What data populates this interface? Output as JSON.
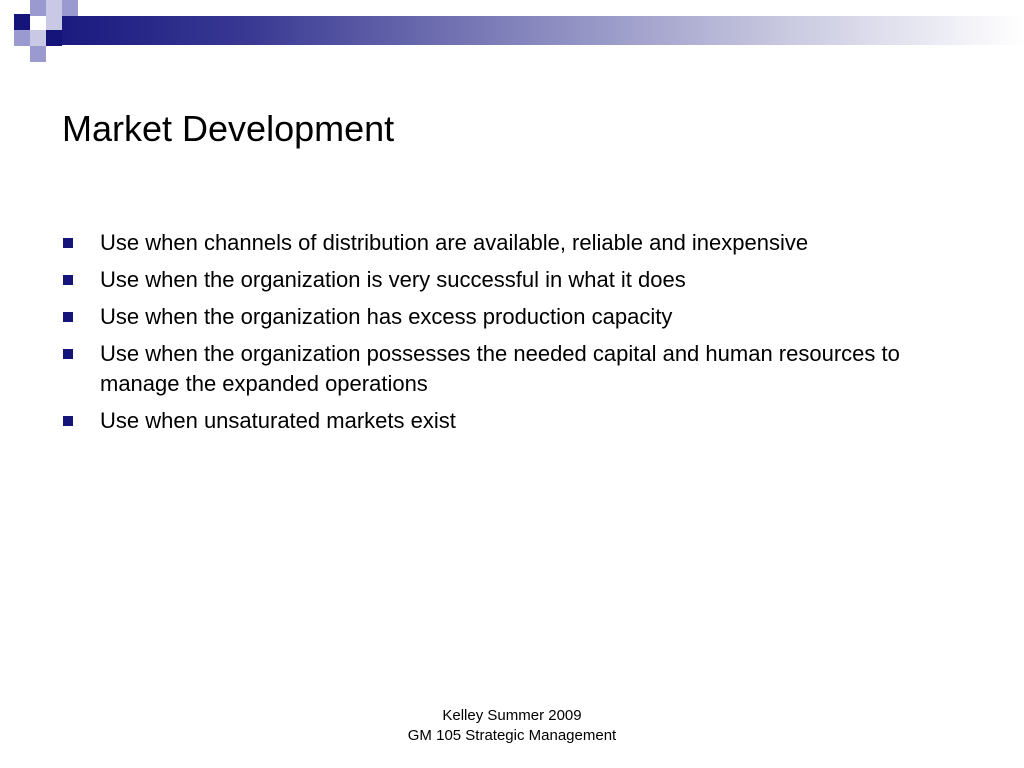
{
  "slide": {
    "title": "Market Development",
    "bullets": [
      "Use when channels of distribution are available, reliable and inexpensive",
      "Use when the organization is very successful in what it does",
      "Use when the organization has excess production capacity",
      "Use when the organization possesses the needed capital and human resources to manage the expanded operations",
      "Use when unsaturated markets exist"
    ],
    "footer": {
      "line1": "Kelley Summer 2009",
      "line2": "GM 105 Strategic Management"
    }
  },
  "colors": {
    "accent_dark": "#14147a",
    "accent_mid": "#9a9ad0",
    "accent_light": "#c9c9e6"
  }
}
